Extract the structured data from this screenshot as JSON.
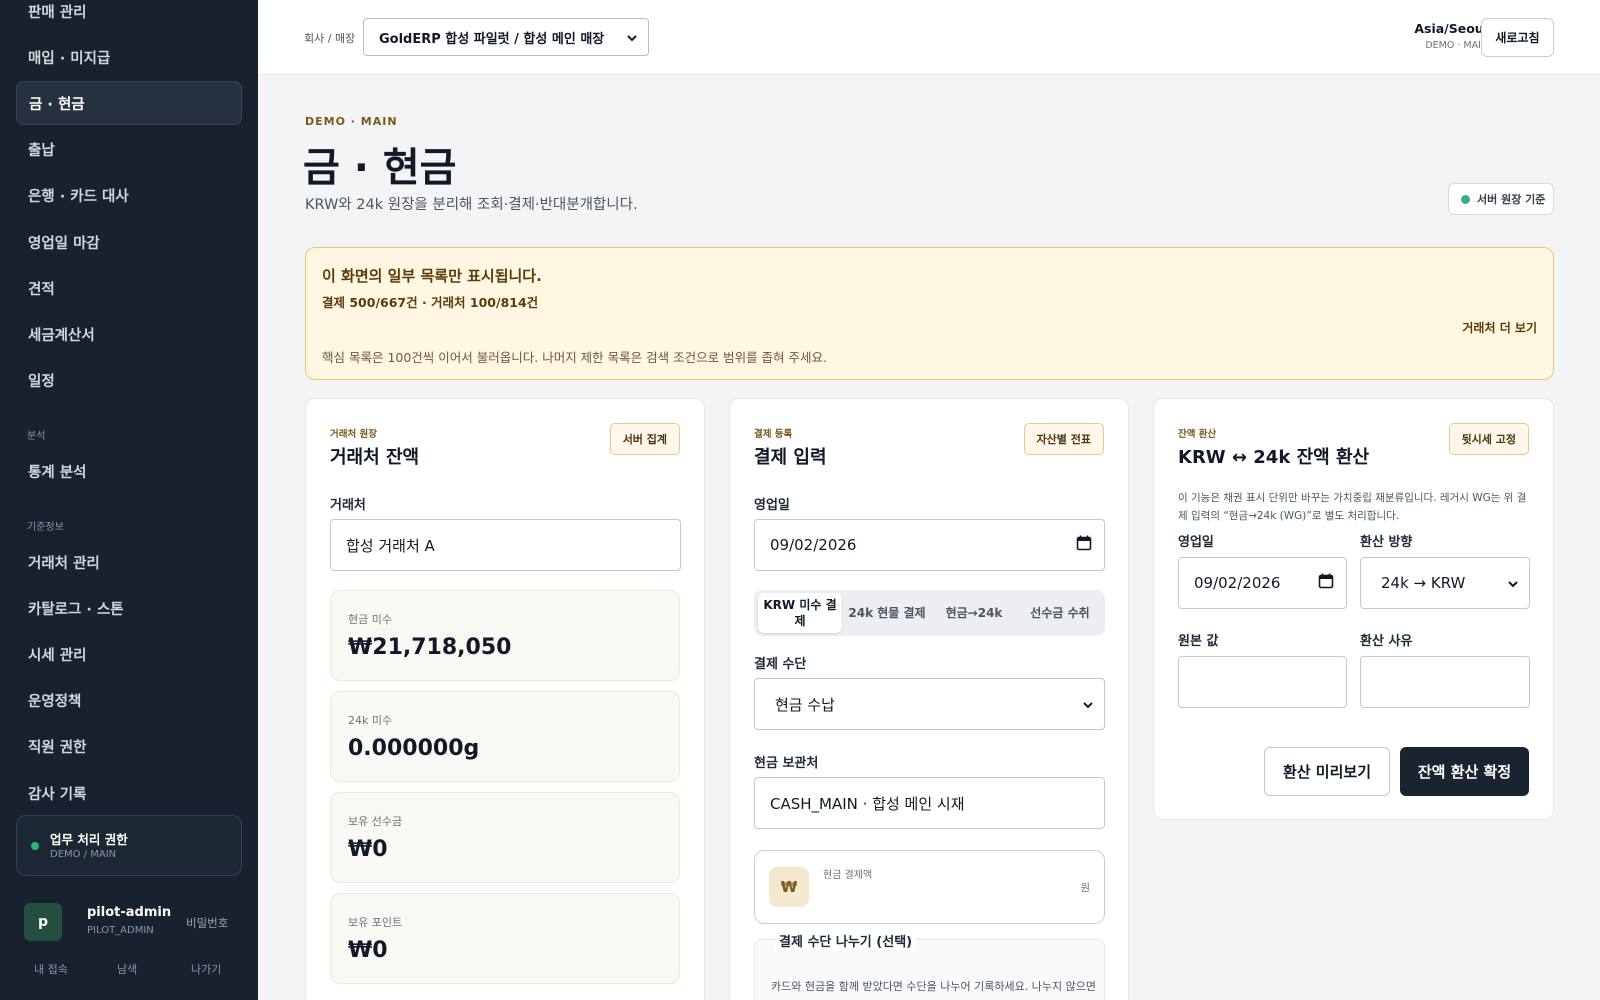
{
  "sidebar": {
    "items": [
      "판매 관리",
      "매입 · 미지급",
      "금 · 현금",
      "출납",
      "은행 · 카드 대사",
      "영업일 마감",
      "견적",
      "세금계산서",
      "일정"
    ],
    "analysis_section": "분석",
    "analysis_items": [
      "통계 분석"
    ],
    "base_section": "기준정보",
    "base_items": [
      "거래처 관리",
      "카탈로그 · 스톤",
      "시세 관리",
      "운영정책",
      "직원 권한",
      "감사 기록"
    ],
    "permission": {
      "title": "업무 처리 권한",
      "sub": "DEMO / MAIN"
    },
    "user": {
      "initial": "p",
      "name": "pilot-admin",
      "role": "PILOT_ADMIN",
      "password_link": "비밀번호"
    },
    "bottom_links": [
      "내 접속",
      "남색",
      "나가기"
    ]
  },
  "topbar": {
    "label": "회사 / 매장",
    "store_select": "GoldERP 합성 파일럿 / 합성 메인 매장",
    "timezone": "Asia/Seoul",
    "timezone_sub": "DEMO · MAIN",
    "refresh": "새로고침"
  },
  "header": {
    "eyebrow": "DEMO · MAIN",
    "title": "금 · 현금",
    "description": "KRW와 24k 원장을 분리해 조회·결제·반대분개합니다.",
    "status": "서버 원장 기준"
  },
  "notice": {
    "title": "이 화면의 일부 목록만 표시됩니다.",
    "counts": "결제 500/667건 · 거래처 100/814건",
    "more_link": "거래처 더 보기",
    "body": "핵심 목록은 100건씩 이어서 불러옵니다. 나머지 제한 목록은 검색 조건으로 범위를 좁혀 주세요."
  },
  "balance_card": {
    "eyebrow": "거래처 원장",
    "title": "거래처 잔액",
    "chip": "서버 집계",
    "customer_label": "거래처",
    "customer_value": "합성 거래처 A",
    "stats": [
      {
        "label": "현금 미수",
        "value": "₩21,718,050"
      },
      {
        "label": "24k 미수",
        "value": "0.000000g"
      },
      {
        "label": "보유 선수금",
        "value": "₩0"
      },
      {
        "label": "보유 포인트",
        "value": "₩0"
      }
    ]
  },
  "payment_card": {
    "eyebrow": "결제 등록",
    "title": "결제 입력",
    "chip": "자산별 전표",
    "date_label": "영업일",
    "date_value": "09/02/2026",
    "tabs": [
      "KRW 미수 결제",
      "24k 현물 결제",
      "현금→24k",
      "선수금 수취"
    ],
    "method_label": "결제 수단",
    "method_value": "현금 수납",
    "vault_label": "현금 보관처",
    "vault_value": "CASH_MAIN · 합성 메인 시재",
    "amount_icon": "₩",
    "amount_label": "현금 결제액",
    "amount_unit": "원",
    "split_title": "결제 수단 나누기 (선택)",
    "split_desc": "카드와 현금을 함께 받았다면 수단을 나누어 기록하세요. 나누지 않으면"
  },
  "convert_card": {
    "eyebrow": "잔액 환산",
    "title": "KRW ↔ 24k 잔액 환산",
    "chip": "뒷시세 고정",
    "description": "이 기능은 채권 표시 단위만 바꾸는 가치중립 재분류입니다. 레거시 WG는 위 결제 입력의 “현금→24k (WG)”로 별도 처리합니다.",
    "date_label": "영업일",
    "date_value": "09/02/2026",
    "direction_label": "환산 방향",
    "direction_value": "24k → KRW",
    "amount_label": "원본 값",
    "reason_label": "환산 사유",
    "preview_button": "환산 미리보기",
    "confirm_button": "잔액 환산 확정"
  }
}
